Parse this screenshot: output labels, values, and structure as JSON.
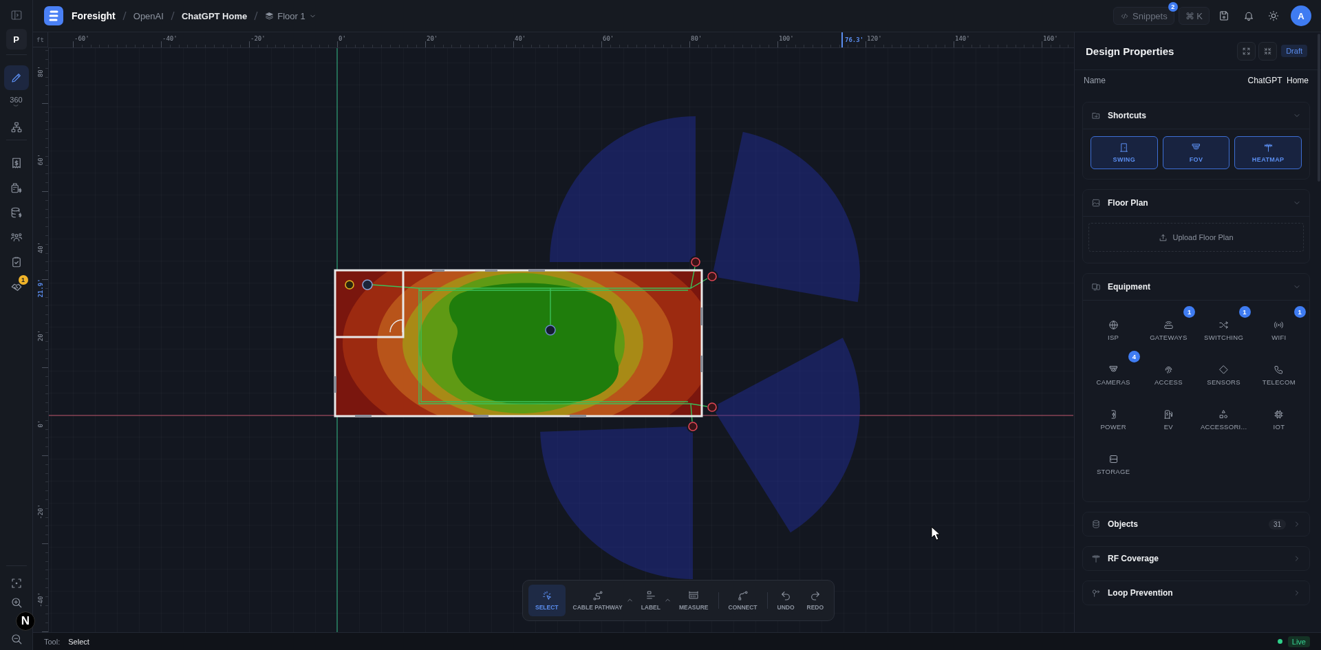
{
  "topbar": {
    "app_name": "Foresight",
    "breadcrumbs": [
      {
        "label": "OpenAI",
        "current": false
      },
      {
        "label": "ChatGPT Home",
        "current": true
      }
    ],
    "floor": "Floor 1",
    "snippets": {
      "label": "Snippets",
      "badge": "2"
    },
    "shortcut": "⌘ K",
    "avatar": "A"
  },
  "sidebar": {
    "workspace": "P",
    "groups": [
      {
        "items": [
          {
            "kind": "pencil",
            "selected": true
          },
          {
            "kind": "view360",
            "label": "360",
            "selected": false
          },
          {
            "kind": "hierarchy",
            "selected": false
          }
        ]
      },
      {
        "items": [
          {
            "kind": "receipt",
            "selected": false
          },
          {
            "kind": "calculator",
            "selected": false
          },
          {
            "kind": "database_dollar",
            "selected": false
          },
          {
            "kind": "people",
            "selected": false
          },
          {
            "kind": "clipboard",
            "selected": false
          },
          {
            "kind": "handshake",
            "selected": false,
            "badge": "1"
          }
        ]
      },
      {
        "items": [
          {
            "kind": "focus",
            "selected": false
          },
          {
            "kind": "zoom_in",
            "selected": false
          },
          {
            "kind": "zoom_out",
            "selected": false
          }
        ]
      }
    ]
  },
  "dev_badge": "N",
  "rulers": {
    "unit": "ft",
    "x_labels": [
      "-60'",
      "-40'",
      "-20'",
      "0'",
      "20'",
      "40'",
      "60'",
      "80'",
      "100'",
      "120'",
      "140'",
      "160'"
    ],
    "x_marker": "76.3'",
    "y_labels": [
      "80'",
      "60'",
      "40'",
      "20'",
      "0'",
      "-20'",
      "-40'"
    ],
    "y_marker": "21.9'"
  },
  "toolbar": {
    "groups": [
      {
        "tools": [
          {
            "kind": "select",
            "label": "SELECT",
            "selected": true,
            "submenu": false
          },
          {
            "kind": "cable",
            "label": "CABLE PATHWAY",
            "selected": false,
            "submenu": true
          },
          {
            "kind": "label",
            "label": "LABEL",
            "selected": false,
            "submenu": true
          },
          {
            "kind": "measure",
            "label": "MEASURE",
            "selected": false,
            "submenu": false
          }
        ]
      },
      {
        "tools": [
          {
            "kind": "connect",
            "label": "CONNECT",
            "selected": false,
            "submenu": false
          }
        ]
      },
      {
        "tools": [
          {
            "kind": "undo",
            "label": "UNDO",
            "selected": false,
            "submenu": false
          },
          {
            "kind": "redo",
            "label": "REDO",
            "selected": false,
            "submenu": false
          }
        ]
      }
    ]
  },
  "panel": {
    "title": "Design Properties",
    "status": "Draft",
    "name_label": "Name",
    "name_value": "ChatGPT  Home",
    "sections": [
      {
        "kind": "shortcuts",
        "title": "Shortcuts",
        "expanded": true,
        "buttons": [
          {
            "kind": "door",
            "label": "SWING"
          },
          {
            "kind": "camera",
            "label": "FOV"
          },
          {
            "kind": "antenna",
            "label": "HEATMAP"
          }
        ]
      },
      {
        "kind": "upload",
        "title": "Floor Plan",
        "expanded": true,
        "upload": "Upload Floor Plan"
      },
      {
        "kind": "equipment",
        "title": "Equipment",
        "expanded": true,
        "items": [
          {
            "kind": "globe",
            "label": "ISP"
          },
          {
            "kind": "router",
            "label": "GATEWAYS",
            "badge": "1"
          },
          {
            "kind": "shuffle",
            "label": "SWITCHING",
            "badge": "1"
          },
          {
            "kind": "signal",
            "label": "WIFI",
            "badge": "1"
          },
          {
            "kind": "camera",
            "label": "CAMERAS",
            "badge": "4"
          },
          {
            "kind": "fingerprint",
            "label": "ACCESS"
          },
          {
            "kind": "diamond",
            "label": "SENSORS"
          },
          {
            "kind": "phone",
            "label": "TELECOM"
          },
          {
            "kind": "plug",
            "label": "POWER"
          },
          {
            "kind": "ev",
            "label": "EV"
          },
          {
            "kind": "shapes",
            "label": "ACCESSORI..."
          },
          {
            "kind": "chip",
            "label": "IOT"
          },
          {
            "kind": "storage",
            "label": "STORAGE"
          }
        ]
      },
      {
        "kind": "objects",
        "title": "Objects",
        "expanded": false,
        "count": "31"
      },
      {
        "kind": "rf",
        "title": "RF Coverage",
        "expanded": false
      },
      {
        "kind": "loop",
        "title": "Loop Prevention",
        "expanded": false
      }
    ]
  },
  "status_bar": {
    "tool_label": "Tool:",
    "tool": "Select",
    "connection": "Live"
  }
}
